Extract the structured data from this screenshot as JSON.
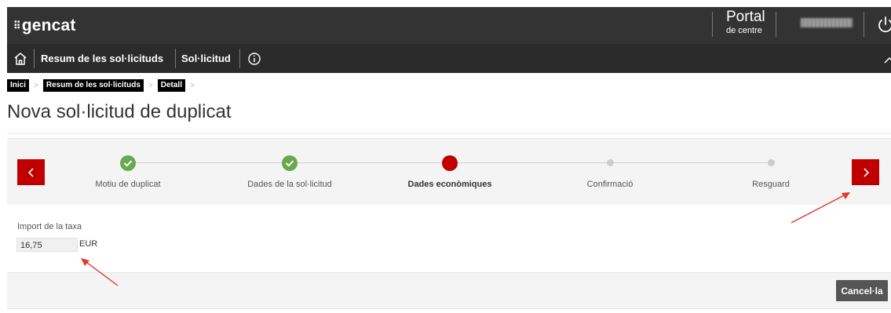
{
  "header": {
    "logo_text": "gencat",
    "logo_dots": "⠿",
    "portal_title": "Portal",
    "portal_subtitle": "de centre"
  },
  "navbar": {
    "items": [
      {
        "label": "Resum de les sol·licituds"
      },
      {
        "label": "Sol·licitud"
      }
    ]
  },
  "breadcrumb": {
    "items": [
      {
        "label": "Inici"
      },
      {
        "label": "Resum de les sol·licituds"
      },
      {
        "label": "Detall"
      }
    ],
    "separator": ">"
  },
  "page": {
    "title": "Nova sol·licitud de duplicat"
  },
  "wizard": {
    "steps": [
      {
        "label": "Motiu de duplicat",
        "status": "completed"
      },
      {
        "label": "Dades de la sol·licitud",
        "status": "completed"
      },
      {
        "label": "Dades econòmiques",
        "status": "active"
      },
      {
        "label": "Confirmació",
        "status": "pending"
      },
      {
        "label": "Resguard",
        "status": "pending"
      }
    ],
    "prev_symbol": "<",
    "next_symbol": ">"
  },
  "form": {
    "fee_label": "Import de la taxa",
    "fee_value": "16,75",
    "fee_unit": "EUR"
  },
  "footer": {
    "cancel_label": "Cancel·la"
  },
  "colors": {
    "topbar": "#333333",
    "accent_red": "#c00000",
    "completed_green": "#6aa84f",
    "pending_gray": "#cccccc",
    "annotation_arrow": "#e03a2f"
  }
}
